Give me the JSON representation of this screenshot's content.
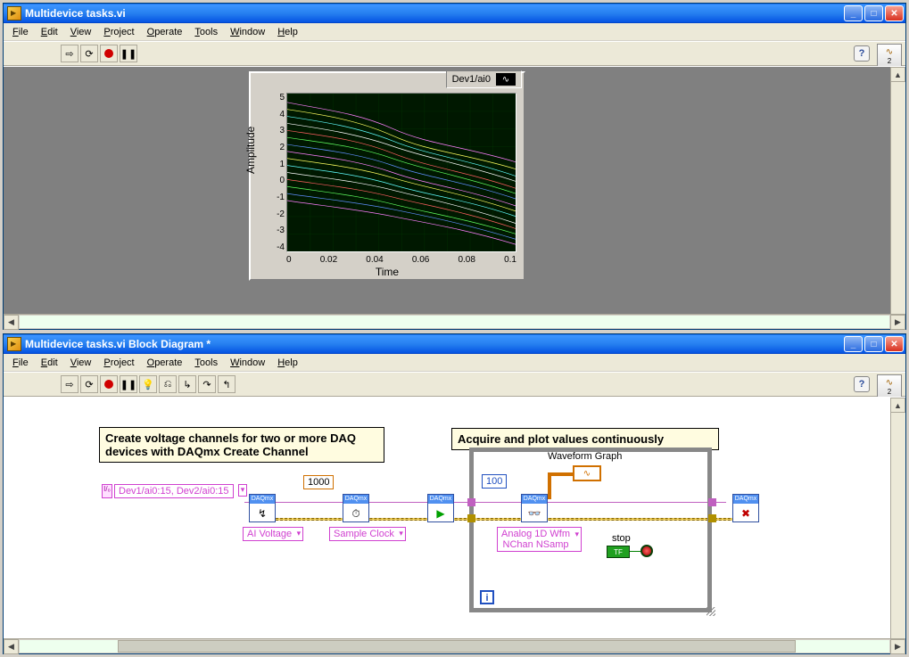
{
  "window1": {
    "title": "Multidevice tasks.vi",
    "menu": {
      "file": "File",
      "edit": "Edit",
      "view": "View",
      "project": "Project",
      "operate": "Operate",
      "tools": "Tools",
      "window": "Window",
      "help": "Help"
    },
    "graph": {
      "legend": "Dev1/ai0",
      "ylabel": "Amplitude",
      "xlabel": "Time",
      "yticks": [
        "5",
        "4",
        "3",
        "2",
        "1",
        "0",
        "-1",
        "-2",
        "-3",
        "-4"
      ],
      "xticks": [
        "0",
        "0.02",
        "0.04",
        "0.06",
        "0.08",
        "0.1"
      ]
    }
  },
  "window2": {
    "title": "Multidevice tasks.vi Block Diagram *",
    "menu": {
      "file": "File",
      "edit": "Edit",
      "view": "View",
      "project": "Project",
      "operate": "Operate",
      "tools": "Tools",
      "window": "Window",
      "help": "Help"
    },
    "comment1": "Create voltage channels for two or more DAQ devices with DAQmx Create Channel",
    "comment2": "Acquire and plot values continuously",
    "channels_string": "Dev1/ai0:15, Dev2/ai0:15",
    "rate_const": "1000",
    "samples_const": "100",
    "ai_voltage": "AI Voltage",
    "sample_clock": "Sample Clock",
    "read_mode1": "Analog 1D Wfm",
    "read_mode2": "NChan NSamp",
    "waveform_label": "Waveform Graph",
    "stop_label": "stop",
    "stop_btn": "TF",
    "daqmx": "DAQmx",
    "iter": "i"
  },
  "help": "?",
  "corner_badge": "2"
}
